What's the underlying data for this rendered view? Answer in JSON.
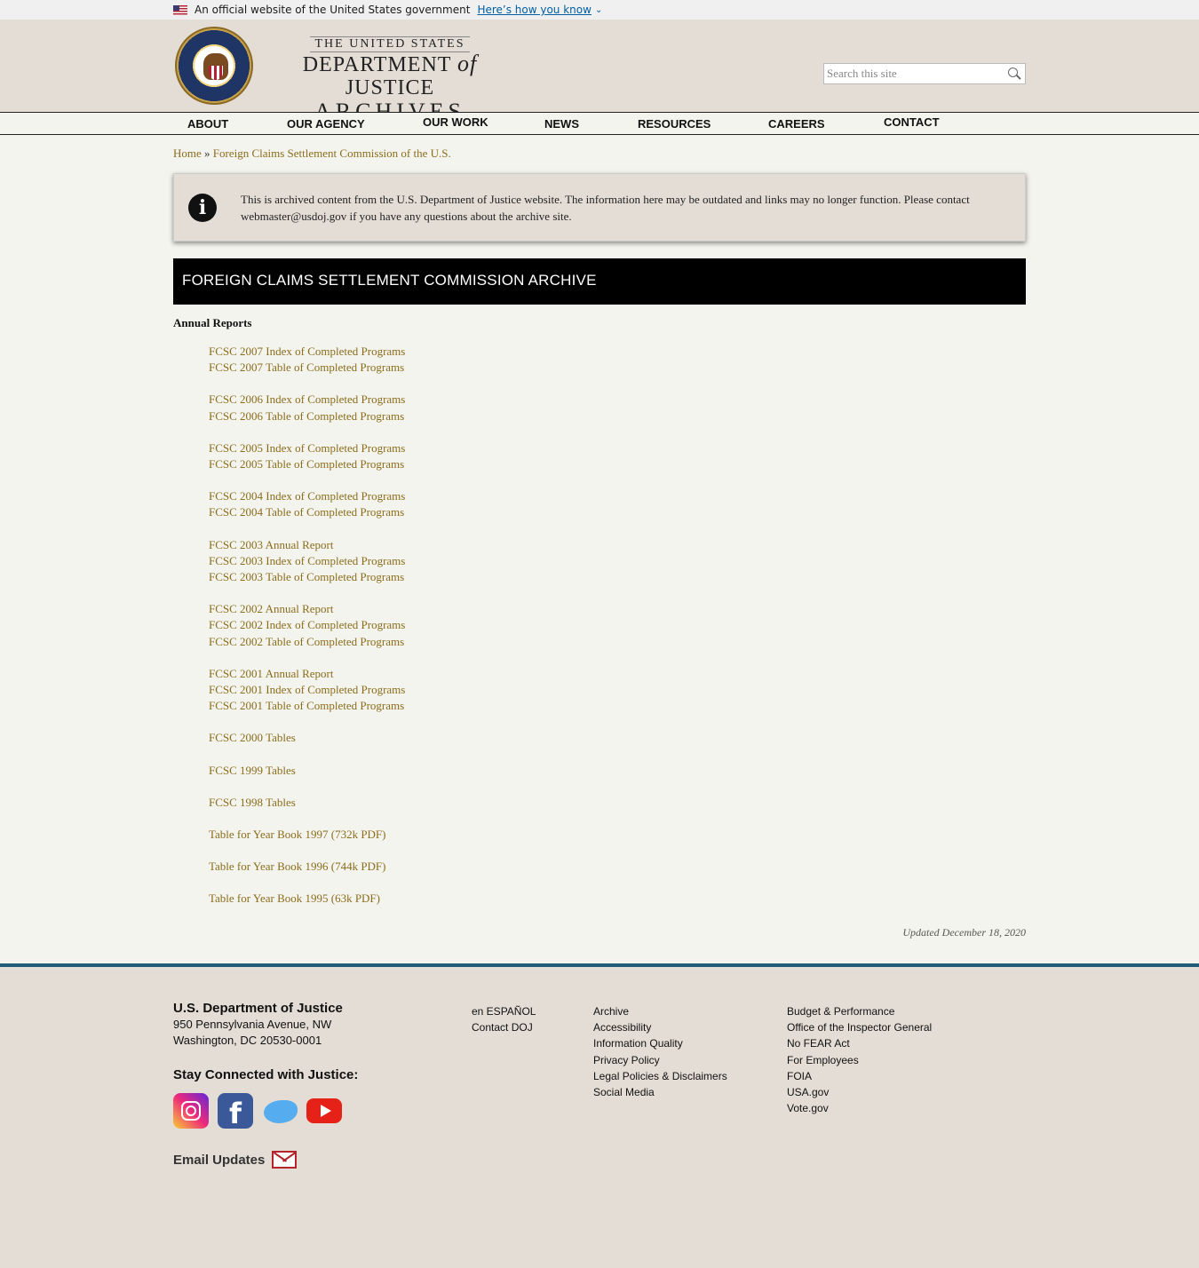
{
  "gov_banner": {
    "text": "An official website of the United States government",
    "link": "Here’s how you know"
  },
  "logo": {
    "line1": "THE UNITED STATES",
    "line2_a": "DEPARTMENT",
    "line2_of": "of",
    "line2_b": "JUSTICE",
    "line3": "ARCHIVES"
  },
  "search": {
    "placeholder": "Search this site"
  },
  "nav": [
    "ABOUT",
    "OUR AGENCY",
    "OUR WORK",
    "NEWS",
    "RESOURCES",
    "CAREERS",
    "CONTACT"
  ],
  "breadcrumb": {
    "home": "Home",
    "sep": "»",
    "current": "Foreign Claims Settlement Commission of the U.S."
  },
  "notice": "This is archived content from the U.S. Department of Justice website. The information here may be outdated and links may no longer function. Please contact webmaster@usdoj.gov if you have any questions about the archive site.",
  "page_title": "FOREIGN CLAIMS SETTLEMENT COMMISSION ARCHIVE",
  "section_heading": "Annual Reports",
  "report_groups": [
    [
      "FCSC 2007 Index of Completed Programs",
      "FCSC 2007 Table of Completed Programs"
    ],
    [
      "FCSC 2006 Index of Completed Programs",
      "FCSC 2006 Table of Completed Programs"
    ],
    [
      "FCSC 2005 Index of Completed Programs",
      "FCSC 2005 Table of Completed Programs"
    ],
    [
      "FCSC 2004 Index of Completed Programs",
      "FCSC 2004 Table of Completed Programs"
    ],
    [
      "FCSC 2003 Annual Report",
      "FCSC 2003 Index of Completed Programs",
      "FCSC 2003 Table of Completed Programs"
    ],
    [
      "FCSC 2002 Annual Report",
      "FCSC 2002 Index of Completed Programs",
      "FCSC 2002 Table of Completed Programs"
    ],
    [
      "FCSC 2001 Annual Report",
      "FCSC 2001 Index of Completed Programs",
      "FCSC 2001 Table of Completed Programs"
    ],
    [
      "FCSC 2000 Tables"
    ],
    [
      "FCSC 1999 Tables"
    ],
    [
      "FCSC 1998 Tables"
    ],
    [
      "Table for Year Book 1997 (732k PDF)"
    ],
    [
      "Table for Year Book 1996 (744k PDF)"
    ],
    [
      "Table for Year Book 1995 (63k PDF)"
    ]
  ],
  "updated": "Updated December 18, 2020",
  "footer": {
    "org": "U.S. Department of Justice",
    "address1": "950 Pennsylvania Avenue, NW",
    "address2": "Washington, DC 20530-0001",
    "stay_connected": "Stay Connected with Justice:",
    "email_updates": "Email Updates",
    "col1": [
      "en ESPAÑOL",
      "Contact DOJ"
    ],
    "col2": [
      "Archive",
      "Accessibility",
      "Information Quality",
      "Privacy Policy",
      "Legal Policies & Disclaimers",
      "Social Media"
    ],
    "col3": [
      "Budget & Performance",
      "Office of the Inspector General",
      "No FEAR Act",
      "For Employees",
      "FOIA",
      "USA.gov",
      "Vote.gov"
    ]
  },
  "social_icons": [
    "instagram-icon",
    "facebook-icon",
    "twitter-icon",
    "youtube-icon"
  ]
}
